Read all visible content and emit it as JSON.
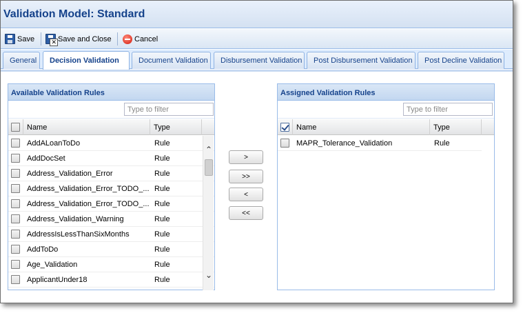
{
  "window": {
    "title": "Validation Model: Standard"
  },
  "toolbar": {
    "save_label": "Save",
    "save_close_label": "Save and Close",
    "cancel_label": "Cancel"
  },
  "tabs": [
    {
      "label": "General",
      "active": false
    },
    {
      "label": "Decision Validation",
      "active": true
    },
    {
      "label": "Document Validation",
      "active": false
    },
    {
      "label": "Disbursement Validation",
      "active": false
    },
    {
      "label": "Post Disbursement Validation",
      "active": false
    },
    {
      "label": "Post Decline Validation",
      "active": false
    }
  ],
  "available": {
    "title": "Available Validation Rules",
    "filter_placeholder": "Type to filter",
    "col_name": "Name",
    "col_type": "Type",
    "rows": [
      {
        "name": "AddALoanToDo",
        "type": "Rule"
      },
      {
        "name": "AddDocSet",
        "type": "Rule"
      },
      {
        "name": "Address_Validation_Error",
        "type": "Rule"
      },
      {
        "name": "Address_Validation_Error_TODO_...",
        "type": "Rule"
      },
      {
        "name": "Address_Validation_Error_TODO_...",
        "type": "Rule"
      },
      {
        "name": "Address_Validation_Warning",
        "type": "Rule"
      },
      {
        "name": "AddressIsLessThanSixMonths",
        "type": "Rule"
      },
      {
        "name": "AddToDo",
        "type": "Rule"
      },
      {
        "name": "Age_Validation",
        "type": "Rule"
      },
      {
        "name": "ApplicantUnder18",
        "type": "Rule"
      }
    ]
  },
  "move_buttons": {
    "add": ">",
    "add_all": ">>",
    "remove": "<",
    "remove_all": "<<"
  },
  "assigned": {
    "title": "Assigned Validation Rules",
    "filter_placeholder": "Type to filter",
    "col_name": "Name",
    "col_type": "Type",
    "rows": [
      {
        "name": "MAPR_Tolerance_Validation",
        "type": "Rule"
      }
    ]
  }
}
